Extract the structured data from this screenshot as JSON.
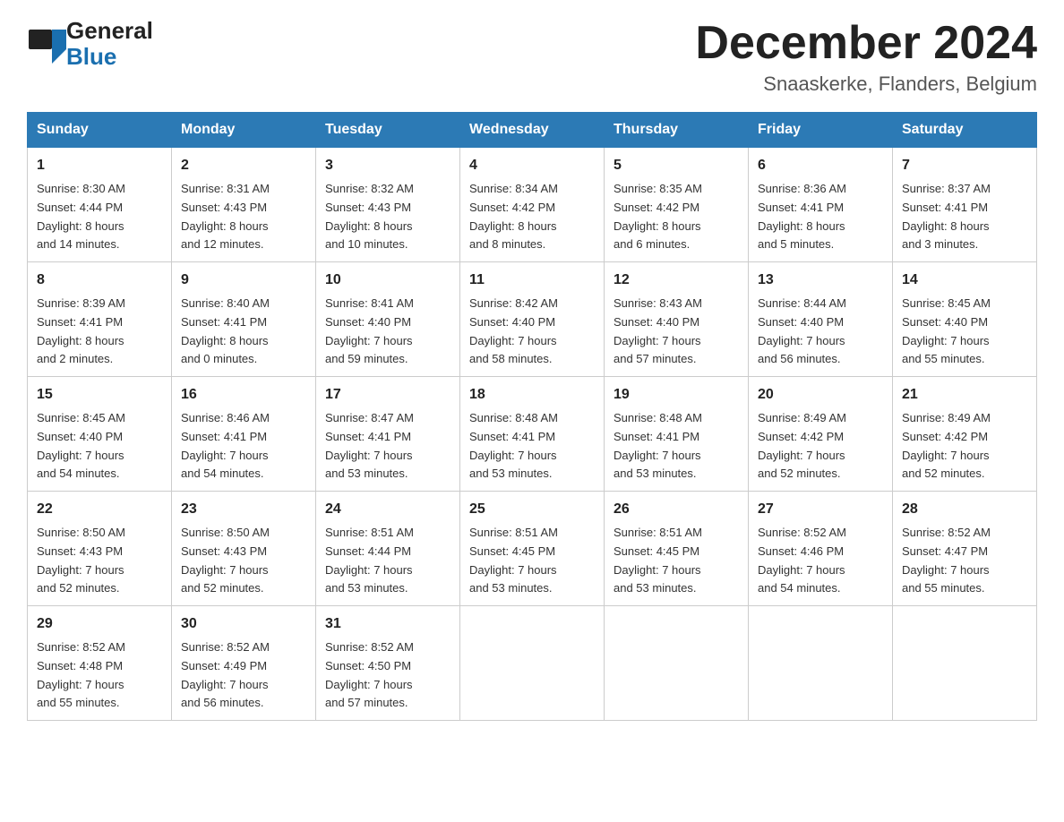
{
  "header": {
    "logo_general": "General",
    "logo_blue": "Blue",
    "month_title": "December 2024",
    "location": "Snaaskerke, Flanders, Belgium"
  },
  "weekdays": [
    "Sunday",
    "Monday",
    "Tuesday",
    "Wednesday",
    "Thursday",
    "Friday",
    "Saturday"
  ],
  "weeks": [
    [
      {
        "day": "1",
        "info": "Sunrise: 8:30 AM\nSunset: 4:44 PM\nDaylight: 8 hours\nand 14 minutes."
      },
      {
        "day": "2",
        "info": "Sunrise: 8:31 AM\nSunset: 4:43 PM\nDaylight: 8 hours\nand 12 minutes."
      },
      {
        "day": "3",
        "info": "Sunrise: 8:32 AM\nSunset: 4:43 PM\nDaylight: 8 hours\nand 10 minutes."
      },
      {
        "day": "4",
        "info": "Sunrise: 8:34 AM\nSunset: 4:42 PM\nDaylight: 8 hours\nand 8 minutes."
      },
      {
        "day": "5",
        "info": "Sunrise: 8:35 AM\nSunset: 4:42 PM\nDaylight: 8 hours\nand 6 minutes."
      },
      {
        "day": "6",
        "info": "Sunrise: 8:36 AM\nSunset: 4:41 PM\nDaylight: 8 hours\nand 5 minutes."
      },
      {
        "day": "7",
        "info": "Sunrise: 8:37 AM\nSunset: 4:41 PM\nDaylight: 8 hours\nand 3 minutes."
      }
    ],
    [
      {
        "day": "8",
        "info": "Sunrise: 8:39 AM\nSunset: 4:41 PM\nDaylight: 8 hours\nand 2 minutes."
      },
      {
        "day": "9",
        "info": "Sunrise: 8:40 AM\nSunset: 4:41 PM\nDaylight: 8 hours\nand 0 minutes."
      },
      {
        "day": "10",
        "info": "Sunrise: 8:41 AM\nSunset: 4:40 PM\nDaylight: 7 hours\nand 59 minutes."
      },
      {
        "day": "11",
        "info": "Sunrise: 8:42 AM\nSunset: 4:40 PM\nDaylight: 7 hours\nand 58 minutes."
      },
      {
        "day": "12",
        "info": "Sunrise: 8:43 AM\nSunset: 4:40 PM\nDaylight: 7 hours\nand 57 minutes."
      },
      {
        "day": "13",
        "info": "Sunrise: 8:44 AM\nSunset: 4:40 PM\nDaylight: 7 hours\nand 56 minutes."
      },
      {
        "day": "14",
        "info": "Sunrise: 8:45 AM\nSunset: 4:40 PM\nDaylight: 7 hours\nand 55 minutes."
      }
    ],
    [
      {
        "day": "15",
        "info": "Sunrise: 8:45 AM\nSunset: 4:40 PM\nDaylight: 7 hours\nand 54 minutes."
      },
      {
        "day": "16",
        "info": "Sunrise: 8:46 AM\nSunset: 4:41 PM\nDaylight: 7 hours\nand 54 minutes."
      },
      {
        "day": "17",
        "info": "Sunrise: 8:47 AM\nSunset: 4:41 PM\nDaylight: 7 hours\nand 53 minutes."
      },
      {
        "day": "18",
        "info": "Sunrise: 8:48 AM\nSunset: 4:41 PM\nDaylight: 7 hours\nand 53 minutes."
      },
      {
        "day": "19",
        "info": "Sunrise: 8:48 AM\nSunset: 4:41 PM\nDaylight: 7 hours\nand 53 minutes."
      },
      {
        "day": "20",
        "info": "Sunrise: 8:49 AM\nSunset: 4:42 PM\nDaylight: 7 hours\nand 52 minutes."
      },
      {
        "day": "21",
        "info": "Sunrise: 8:49 AM\nSunset: 4:42 PM\nDaylight: 7 hours\nand 52 minutes."
      }
    ],
    [
      {
        "day": "22",
        "info": "Sunrise: 8:50 AM\nSunset: 4:43 PM\nDaylight: 7 hours\nand 52 minutes."
      },
      {
        "day": "23",
        "info": "Sunrise: 8:50 AM\nSunset: 4:43 PM\nDaylight: 7 hours\nand 52 minutes."
      },
      {
        "day": "24",
        "info": "Sunrise: 8:51 AM\nSunset: 4:44 PM\nDaylight: 7 hours\nand 53 minutes."
      },
      {
        "day": "25",
        "info": "Sunrise: 8:51 AM\nSunset: 4:45 PM\nDaylight: 7 hours\nand 53 minutes."
      },
      {
        "day": "26",
        "info": "Sunrise: 8:51 AM\nSunset: 4:45 PM\nDaylight: 7 hours\nand 53 minutes."
      },
      {
        "day": "27",
        "info": "Sunrise: 8:52 AM\nSunset: 4:46 PM\nDaylight: 7 hours\nand 54 minutes."
      },
      {
        "day": "28",
        "info": "Sunrise: 8:52 AM\nSunset: 4:47 PM\nDaylight: 7 hours\nand 55 minutes."
      }
    ],
    [
      {
        "day": "29",
        "info": "Sunrise: 8:52 AM\nSunset: 4:48 PM\nDaylight: 7 hours\nand 55 minutes."
      },
      {
        "day": "30",
        "info": "Sunrise: 8:52 AM\nSunset: 4:49 PM\nDaylight: 7 hours\nand 56 minutes."
      },
      {
        "day": "31",
        "info": "Sunrise: 8:52 AM\nSunset: 4:50 PM\nDaylight: 7 hours\nand 57 minutes."
      },
      {
        "day": "",
        "info": ""
      },
      {
        "day": "",
        "info": ""
      },
      {
        "day": "",
        "info": ""
      },
      {
        "day": "",
        "info": ""
      }
    ]
  ]
}
